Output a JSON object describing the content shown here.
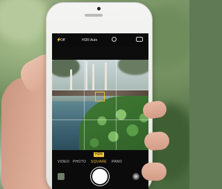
{
  "camera_app": {
    "top_bar": {
      "flash_label": "Off",
      "hdr_label": "HDR Auto",
      "icons": [
        "flash-icon",
        "timer-icon",
        "switch-camera-icon"
      ]
    },
    "hdr_badge": "HDR",
    "modes": [
      "VIDEO",
      "PHOTO",
      "SQUARE",
      "PANO"
    ],
    "active_mode": "SQUARE",
    "colors": {
      "accent_yellow": "#f3c23b",
      "phone_body": "#f0f0ee",
      "screen_black": "#0b0b0b"
    }
  }
}
